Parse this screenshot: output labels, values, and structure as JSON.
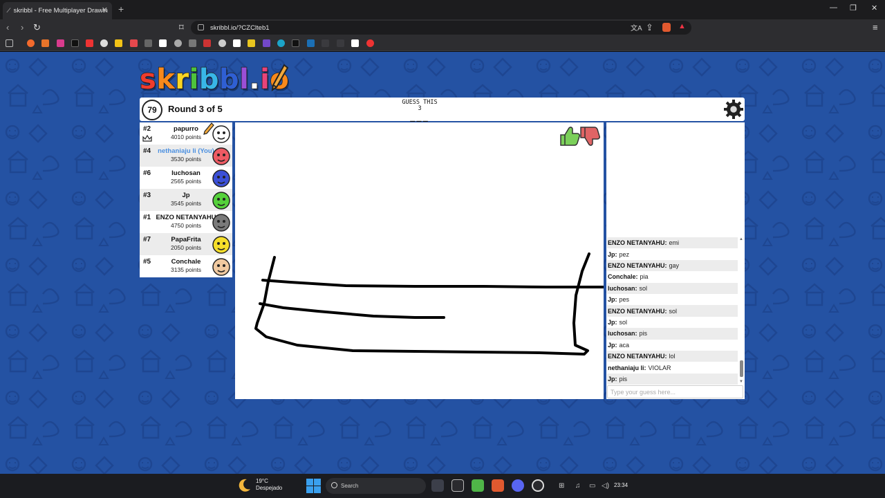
{
  "browser": {
    "tab_title": "skribbl - Free Multiplayer Drawin",
    "url": "skribbl.io/?CZClteb1"
  },
  "game": {
    "logo": [
      "s",
      "k",
      "r",
      "i",
      "b",
      "b",
      "l",
      ".",
      "i",
      "o"
    ],
    "logo_colors": [
      "#ef3c2d",
      "#f8891c",
      "#f9d423",
      "#4ec33d",
      "#38b6e8",
      "#2f5fd3",
      "#9b4fd6",
      "#ffffff",
      "#e8447a",
      "#f8891c"
    ],
    "timer": "79",
    "round": "Round 3 of 5",
    "guess_label": "GUESS THIS",
    "word_length": "3",
    "word_blanks": "___"
  },
  "players": [
    {
      "rank": "#2",
      "name": "papurro",
      "points": "4010 points",
      "you": false,
      "color": "#ffffff"
    },
    {
      "rank": "#4",
      "name": "nethaniaju li (You)",
      "points": "3530 points",
      "you": true,
      "color": "#ee5a63"
    },
    {
      "rank": "#6",
      "name": "luchosan",
      "points": "2565 points",
      "you": false,
      "color": "#3b4fd6"
    },
    {
      "rank": "#3",
      "name": "Jp",
      "points": "3545 points",
      "you": false,
      "color": "#55d13b"
    },
    {
      "rank": "#1",
      "name": "ENZO NETANYAHU",
      "points": "4750 points",
      "you": false,
      "color": "#7a7a7a"
    },
    {
      "rank": "#7",
      "name": "PapaFrita",
      "points": "2050 points",
      "you": false,
      "color": "#f5de2a"
    },
    {
      "rank": "#5",
      "name": "Conchale",
      "points": "3135 points",
      "you": false,
      "color": "#f0c9a0"
    }
  ],
  "chat": [
    {
      "user": "ENZO NETANYAHU:",
      "text": "emi"
    },
    {
      "user": "Jp:",
      "text": "pez"
    },
    {
      "user": "ENZO NETANYAHU:",
      "text": "gay"
    },
    {
      "user": "Conchale:",
      "text": "pia"
    },
    {
      "user": "luchosan:",
      "text": "sol"
    },
    {
      "user": "Jp:",
      "text": "pes"
    },
    {
      "user": "ENZO NETANYAHU:",
      "text": "sol"
    },
    {
      "user": "Jp:",
      "text": "sol"
    },
    {
      "user": "luchosan:",
      "text": "pis"
    },
    {
      "user": "Jp:",
      "text": "aca"
    },
    {
      "user": "ENZO NETANYAHU:",
      "text": "lol"
    },
    {
      "user": "nethaniaju li:",
      "text": "VIOLAR"
    },
    {
      "user": "Jp:",
      "text": "pis"
    }
  ],
  "chat_placeholder": "Type your guess here...",
  "taskbar": {
    "temperature": "19°C",
    "weather": "Despejado",
    "search": "Search",
    "time": "23:34"
  }
}
